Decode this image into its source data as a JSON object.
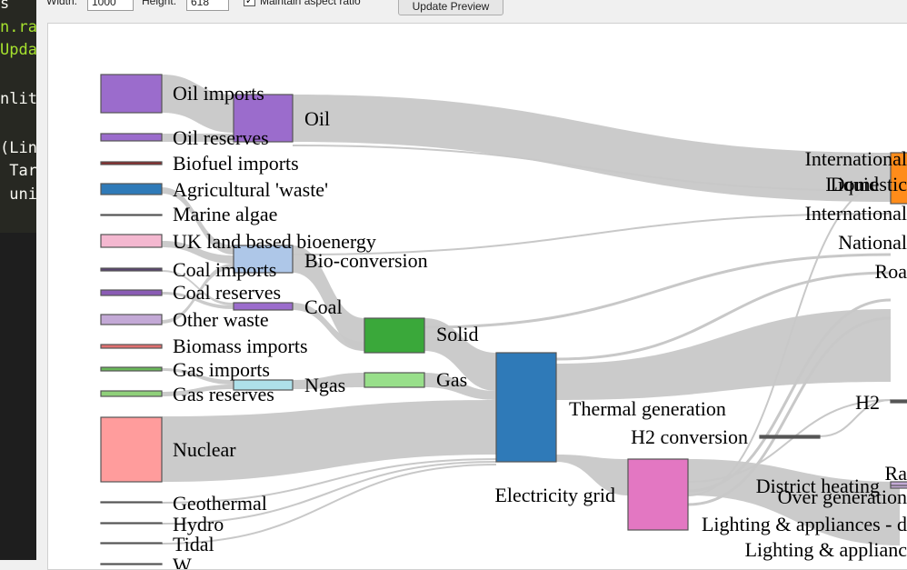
{
  "editor": {
    "lines": [
      {
        "text": "s",
        "color": "#f8f8f2"
      },
      {
        "text": "n.ra",
        "color": "#a6e22e"
      },
      {
        "text": "Updat",
        "color": "#a6e22e"
      },
      {
        "text": "",
        "color": "#f8f8f2"
      },
      {
        "text": "nlit",
        "color": "#f8f8f2"
      },
      {
        "text": "",
        "color": "#f8f8f2"
      },
      {
        "text": "(Lin",
        "color": "#f8f8f2"
      },
      {
        "text": " Tar",
        "color": "#f8f8f2"
      },
      {
        "text": " uni",
        "color": "#f8f8f2"
      }
    ]
  },
  "toolbar": {
    "width_label": "Width:",
    "width_value": "1000",
    "height_label": "Height:",
    "height_value": "618",
    "aspect_checked": "✓",
    "aspect_label": "Maintain aspect ratio",
    "update_button": "Update Preview"
  },
  "sankey": {
    "link_color": "#c8c8c8",
    "source_nodes": [
      {
        "name": "Oil imports",
        "color": "#9b6ccc"
      },
      {
        "name": "Oil reserves",
        "color": "#9b6ccc"
      },
      {
        "name": "Biofuel imports",
        "color": "#8b2b2b"
      },
      {
        "name": "Agricultural 'waste'",
        "color": "#2f7ab8"
      },
      {
        "name": "Marine algae",
        "color": "#7a3030"
      },
      {
        "name": "UK land based bioenergy",
        "color": "#f4b8d0"
      },
      {
        "name": "Coal imports",
        "color": "#5a4570"
      },
      {
        "name": "Coal reserves",
        "color": "#8a5cb5"
      },
      {
        "name": "Other waste",
        "color": "#c3a9d6"
      },
      {
        "name": "Biomass imports",
        "color": "#e07070"
      },
      {
        "name": "Gas imports",
        "color": "#6ab85a"
      },
      {
        "name": "Gas reserves",
        "color": "#8fd07a"
      },
      {
        "name": "Nuclear",
        "color": "#ff9c9c"
      },
      {
        "name": "Geothermal",
        "color": "#6b7f90"
      },
      {
        "name": "Hydro",
        "color": "#9a5a20"
      },
      {
        "name": "Tidal",
        "color": "#8a4a8a"
      },
      {
        "name": "W",
        "color": "#777777"
      }
    ],
    "mid_nodes": [
      {
        "name": "Oil",
        "color": "#9b6ccc"
      },
      {
        "name": "Bio-conversion",
        "color": "#aec7e8"
      },
      {
        "name": "Coal",
        "color": "#9b6ccc"
      },
      {
        "name": "Ngas",
        "color": "#aee0ea"
      },
      {
        "name": "Solid",
        "color": "#3aa83a"
      },
      {
        "name": "Gas",
        "color": "#98df8a"
      },
      {
        "name": "Thermal generation",
        "color": "#2f7ab8"
      },
      {
        "name": "Electricity grid",
        "color": "#e377c2"
      },
      {
        "name": "H2 conversion",
        "color": "#555555"
      }
    ],
    "right_nodes": [
      {
        "name": "International",
        "color": "#ff8c1a"
      },
      {
        "name": "Liquid",
        "color": "#ff8c1a"
      },
      {
        "name": "Domestic",
        "color": "#ff8c1a"
      },
      {
        "name": "International",
        "color": "#ff8c1a"
      },
      {
        "name": "National",
        "color": "#ff8c1a"
      },
      {
        "name": "Roa",
        "color": "#ff8c1a"
      },
      {
        "name": "H2",
        "color": "#555555"
      },
      {
        "name": "District heating",
        "color": "#c3a9d6"
      },
      {
        "name": "Over generation",
        "color": "#c3a9d6"
      },
      {
        "name": "Ra",
        "color": "#c3a9d6"
      },
      {
        "name": "Lighting & appliances - d",
        "color": "#c3a9d6"
      },
      {
        "name": "Lighting & applianc",
        "color": "#c3a9d6"
      }
    ]
  }
}
